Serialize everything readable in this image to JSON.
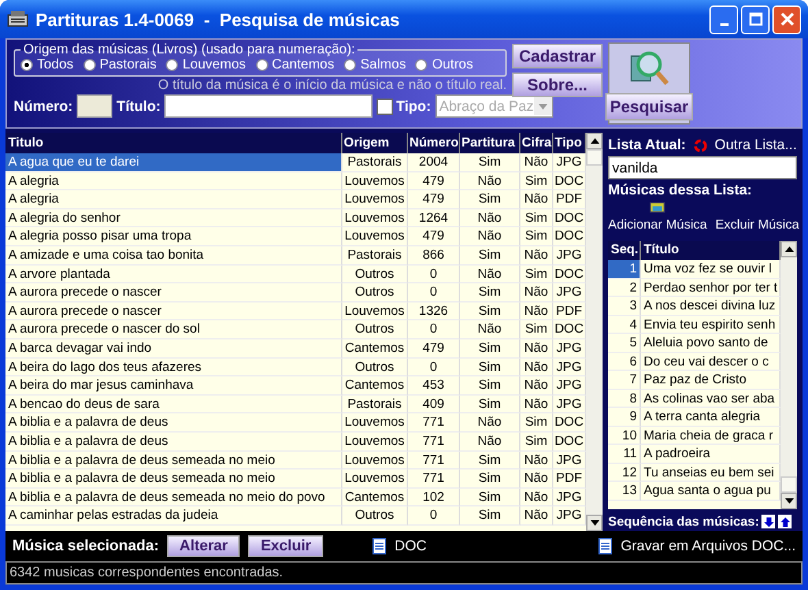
{
  "window": {
    "title": "Partituras 1.4-0069  -  Pesquisa de músicas"
  },
  "origin_group": {
    "label": "Origem das músicas (Livros) (usado para numeração):",
    "options": [
      {
        "label": "Todos",
        "selected": true
      },
      {
        "label": "Pastorais",
        "selected": false
      },
      {
        "label": "Louvemos",
        "selected": false
      },
      {
        "label": "Cantemos",
        "selected": false
      },
      {
        "label": "Salmos",
        "selected": false
      },
      {
        "label": "Outros",
        "selected": false
      }
    ]
  },
  "hint": "O título da música é o início da música e não o título real.",
  "fields": {
    "number_label": "Número:",
    "title_label": "Título:",
    "type_checkbox": {
      "label": "Tipo:",
      "checked": false
    },
    "type_combo": {
      "value": "Abraço da Paz",
      "disabled": true
    }
  },
  "buttons": {
    "register": "Cadastrar",
    "about": "Sobre...",
    "search": "Pesquisar"
  },
  "table": {
    "columns": [
      "Titulo",
      "Origem",
      "Número",
      "Partitura",
      "Cifra",
      "Tipo"
    ],
    "rows": [
      {
        "cells": [
          "A agua que eu te darei",
          "Pastorais",
          "2004",
          "Sim",
          "Não",
          "JPG"
        ],
        "selected": true
      },
      {
        "cells": [
          "A alegria",
          "Louvemos",
          "479",
          "Não",
          "Sim",
          "DOC"
        ],
        "selected": false
      },
      {
        "cells": [
          "A alegria",
          "Louvemos",
          "479",
          "Sim",
          "Não",
          "PDF"
        ],
        "selected": false
      },
      {
        "cells": [
          "A alegria do senhor",
          "Louvemos",
          "1264",
          "Não",
          "Sim",
          "DOC"
        ],
        "selected": false
      },
      {
        "cells": [
          "A alegria posso pisar uma tropa",
          "Louvemos",
          "479",
          "Não",
          "Sim",
          "DOC"
        ],
        "selected": false
      },
      {
        "cells": [
          "A amizade e uma coisa tao bonita",
          "Pastorais",
          "866",
          "Sim",
          "Não",
          "JPG"
        ],
        "selected": false
      },
      {
        "cells": [
          "A arvore plantada",
          "Outros",
          "0",
          "Não",
          "Sim",
          "DOC"
        ],
        "selected": false
      },
      {
        "cells": [
          "A aurora precede o nascer",
          "Outros",
          "0",
          "Sim",
          "Não",
          "JPG"
        ],
        "selected": false
      },
      {
        "cells": [
          "A aurora precede o nascer",
          "Louvemos",
          "1326",
          "Sim",
          "Não",
          "PDF"
        ],
        "selected": false
      },
      {
        "cells": [
          "A aurora precede o nascer do sol",
          "Outros",
          "0",
          "Não",
          "Sim",
          "DOC"
        ],
        "selected": false
      },
      {
        "cells": [
          "A barca devagar vai indo",
          "Cantemos",
          "479",
          "Sim",
          "Não",
          "JPG"
        ],
        "selected": false
      },
      {
        "cells": [
          "A beira do lago dos teus afazeres",
          "Outros",
          "0",
          "Sim",
          "Não",
          "JPG"
        ],
        "selected": false
      },
      {
        "cells": [
          "A beira do mar jesus caminhava",
          "Cantemos",
          "453",
          "Sim",
          "Não",
          "JPG"
        ],
        "selected": false
      },
      {
        "cells": [
          "A bencao do deus de sara",
          "Pastorais",
          "409",
          "Sim",
          "Não",
          "JPG"
        ],
        "selected": false
      },
      {
        "cells": [
          "A biblia e a palavra de deus",
          "Louvemos",
          "771",
          "Não",
          "Sim",
          "DOC"
        ],
        "selected": false
      },
      {
        "cells": [
          "A biblia e a palavra de deus",
          "Louvemos",
          "771",
          "Não",
          "Sim",
          "DOC"
        ],
        "selected": false
      },
      {
        "cells": [
          "A biblia e a palavra de deus semeada no meio",
          "Louvemos",
          "771",
          "Sim",
          "Não",
          "JPG"
        ],
        "selected": false
      },
      {
        "cells": [
          "A biblia e a palavra de deus semeada no meio",
          "Louvemos",
          "771",
          "Sim",
          "Não",
          "PDF"
        ],
        "selected": false
      },
      {
        "cells": [
          "A biblia e a palavra de deus semeada no meio do povo",
          "Cantemos",
          "102",
          "Sim",
          "Não",
          "JPG"
        ],
        "selected": false
      },
      {
        "cells": [
          "A caminhar pelas estradas da judeia",
          "Outros",
          "0",
          "Sim",
          "Não",
          "JPG"
        ],
        "selected": false
      }
    ]
  },
  "list_panel": {
    "current_label": "Lista Atual:",
    "other_list": "Outra Lista...",
    "list_name": "vanilda",
    "songs_label": "Músicas dessa Lista:",
    "add": "Adicionar Música",
    "remove": "Excluir Música",
    "columns": [
      "Seq.",
      "Título"
    ],
    "rows": [
      {
        "seq": "1",
        "title": "Uma voz fez se ouvir l",
        "selected": true
      },
      {
        "seq": "2",
        "title": "Perdao senhor por ter t",
        "selected": false
      },
      {
        "seq": "3",
        "title": "A nos descei divina luz",
        "selected": false
      },
      {
        "seq": "4",
        "title": "Envia teu espirito senh",
        "selected": false
      },
      {
        "seq": "5",
        "title": "Aleluia povo santo de",
        "selected": false
      },
      {
        "seq": "6",
        "title": "Do ceu vai descer o c",
        "selected": false
      },
      {
        "seq": "7",
        "title": "Paz paz de Cristo",
        "selected": false
      },
      {
        "seq": "8",
        "title": "As colinas vao ser aba",
        "selected": false
      },
      {
        "seq": "9",
        "title": "A terra canta alegria",
        "selected": false
      },
      {
        "seq": "10",
        "title": "Maria cheia de graca r",
        "selected": false
      },
      {
        "seq": "11",
        "title": "A padroeira",
        "selected": false
      },
      {
        "seq": "12",
        "title": "Tu anseias eu bem sei",
        "selected": false
      },
      {
        "seq": "13",
        "title": "Agua santa o agua pu",
        "selected": false
      }
    ],
    "sequence_label": "Sequência das músicas:",
    "save": "Gravar em Arquivos DOC..."
  },
  "selected_bar": {
    "label": "Música selecionada:",
    "buttons": [
      "Alterar",
      "Excluir"
    ],
    "file_type": "DOC"
  },
  "status_bar": "6342 musicas correspondentes encontradas."
}
